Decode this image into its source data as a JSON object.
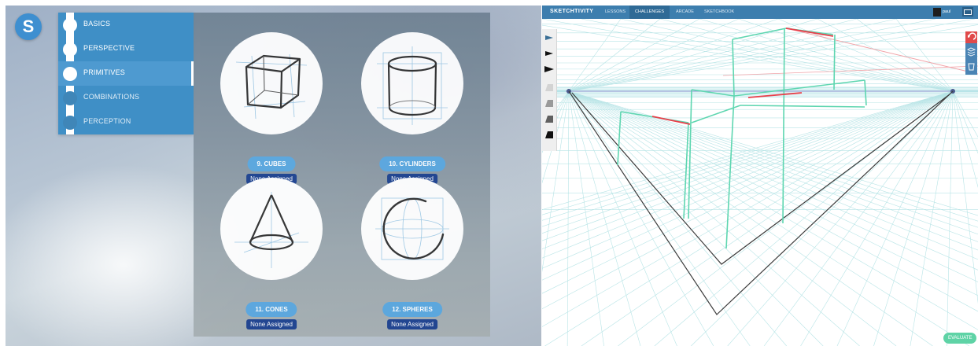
{
  "left": {
    "logo_letter": "S",
    "nav": {
      "items": [
        {
          "label": "BASICS",
          "state": "done"
        },
        {
          "label": "PERSPECTIVE",
          "state": "done"
        },
        {
          "label": "PRIMITIVES",
          "state": "active"
        },
        {
          "label": "COMBINATIONS",
          "state": "locked"
        },
        {
          "label": "PERCEPTION",
          "state": "locked"
        }
      ]
    },
    "cards": [
      {
        "label": "9. CUBES",
        "status": "None Assigned",
        "icon": "cube-icon"
      },
      {
        "label": "10. CYLINDERS",
        "status": "None Assigned",
        "icon": "cylinder-icon"
      },
      {
        "label": "11. CONES",
        "status": "None Assigned",
        "icon": "cone-icon"
      },
      {
        "label": "12. SPHERES",
        "status": "None Assigned",
        "icon": "sphere-icon"
      }
    ]
  },
  "right": {
    "brand": "SKETCHTIVITY",
    "nav": [
      "LESSONS",
      "CHALLENGES",
      "ARCADE",
      "SKETCHBOOK"
    ],
    "active_nav": "CHALLENGES",
    "user": "paul",
    "evaluate_label": "EVALUATE",
    "tools": [
      "pen-light-icon",
      "pen-medium-icon",
      "pen-bold-icon",
      "shade-light-icon",
      "shade-medium-icon",
      "shade-dark-icon",
      "shade-black-icon"
    ],
    "right_tools": [
      "undo-icon",
      "grid-icon",
      "clear-icon"
    ]
  },
  "colors": {
    "accent_blue": "#3f8fc6",
    "badge_navy": "#163c8c",
    "stroke_green": "#5ed6b0",
    "stroke_red": "#e8404b",
    "evaluate_green": "#5fd3a6"
  }
}
